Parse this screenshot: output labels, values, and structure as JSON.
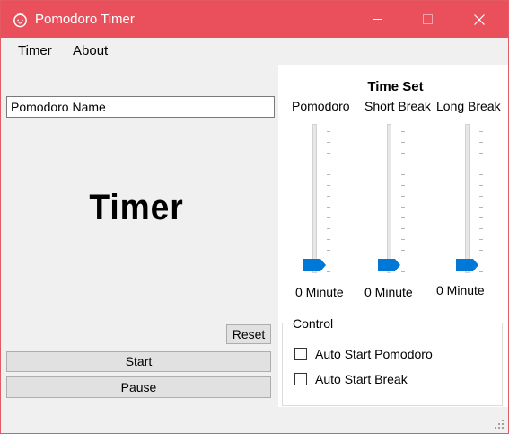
{
  "window": {
    "title": "Pomodoro Timer",
    "titlebar_color": "#e9505b"
  },
  "menu": {
    "items": [
      "Timer",
      "About"
    ]
  },
  "left": {
    "name_input_value": "Pomodoro Name",
    "timer_text": "Timer",
    "reset_label": "Reset",
    "start_label": "Start",
    "pause_label": "Pause"
  },
  "time_set": {
    "title": "Time Set",
    "accent_color": "#0078d7",
    "sliders": [
      {
        "label": "Pomodoro",
        "value_text": "0 Minute",
        "value": 0
      },
      {
        "label": "Short Break",
        "value_text": "0 Minute",
        "value": 0
      },
      {
        "label": "Long Break",
        "value_text": "0 Minute",
        "value": 0
      }
    ]
  },
  "control": {
    "legend": "Control",
    "checkboxes": [
      {
        "label": "Auto Start Pomodoro",
        "checked": false
      },
      {
        "label": "Auto Start Break",
        "checked": false
      }
    ]
  }
}
